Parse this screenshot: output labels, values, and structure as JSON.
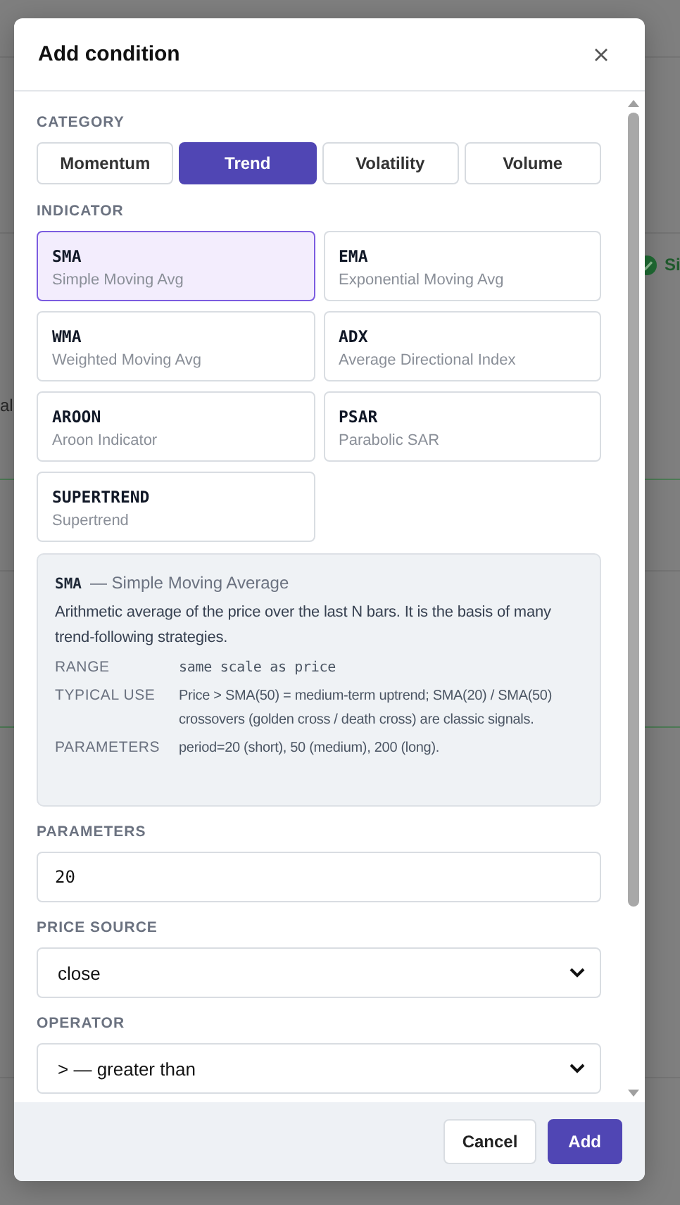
{
  "background": {
    "left_text": "al",
    "right_text": "Si"
  },
  "dialog": {
    "title": "Add condition"
  },
  "category": {
    "label": "CATEGORY",
    "options": [
      {
        "label": "Momentum",
        "selected": false
      },
      {
        "label": "Trend",
        "selected": true
      },
      {
        "label": "Volatility",
        "selected": false
      },
      {
        "label": "Volume",
        "selected": false
      }
    ]
  },
  "indicator": {
    "label": "INDICATOR",
    "options": [
      {
        "code": "SMA",
        "name": "Simple Moving Avg",
        "selected": true
      },
      {
        "code": "EMA",
        "name": "Exponential Moving Avg",
        "selected": false
      },
      {
        "code": "WMA",
        "name": "Weighted Moving Avg",
        "selected": false
      },
      {
        "code": "ADX",
        "name": "Average Directional Index",
        "selected": false
      },
      {
        "code": "AROON",
        "name": "Aroon Indicator",
        "selected": false
      },
      {
        "code": "PSAR",
        "name": "Parabolic SAR",
        "selected": false
      },
      {
        "code": "SUPERTREND",
        "name": "Supertrend",
        "selected": false
      }
    ]
  },
  "info": {
    "code": "SMA",
    "title": "— Simple Moving Average",
    "description": "Arithmetic average of the price over the last N bars. It is the basis of many trend-following strategies.",
    "rows": [
      {
        "key": "RANGE",
        "value": "same scale as price",
        "kind": "mono"
      },
      {
        "key": "TYPICAL USE",
        "value": "Price > SMA(50) = medium-term uptrend; SMA(20) / SMA(50) crossovers (golden cross / death cross) are classic signals.",
        "kind": "text"
      },
      {
        "key": "PARAMETERS",
        "value": "period=20 (short), 50 (medium), 200 (long).",
        "kind": "text"
      }
    ]
  },
  "parameters": {
    "label": "PARAMETERS",
    "value": "20"
  },
  "price_source": {
    "label": "PRICE SOURCE",
    "value": "close"
  },
  "operator": {
    "label": "OPERATOR",
    "value": "> — greater than"
  },
  "buttons": [
    {
      "label": "Cancel",
      "kind": "secondary"
    },
    {
      "label": "Add",
      "kind": "primary"
    }
  ]
}
